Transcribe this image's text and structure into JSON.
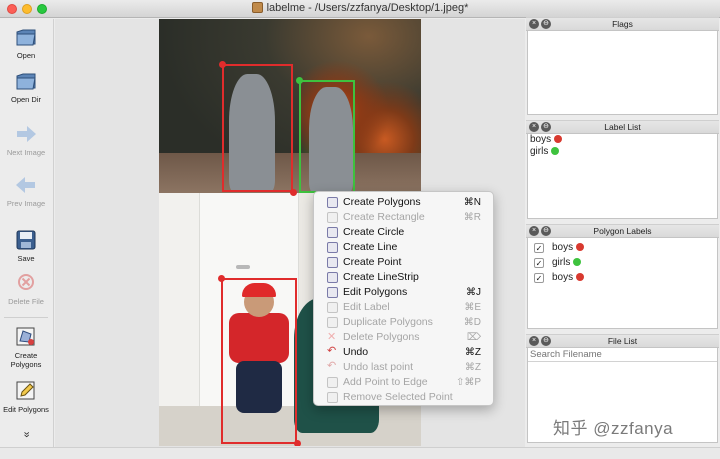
{
  "window": {
    "title": "labelme - /Users/zzfanya/Desktop/1.jpeg*"
  },
  "toolbar": {
    "items": [
      {
        "label": "Open",
        "icon": "folder-icon",
        "enabled": true
      },
      {
        "label": "Open Dir",
        "icon": "folder-icon",
        "enabled": true
      },
      {
        "label": "Next Image",
        "icon": "arrow-right-icon",
        "enabled": false
      },
      {
        "label": "Prev Image",
        "icon": "arrow-left-icon",
        "enabled": false
      },
      {
        "label": "Save",
        "icon": "floppy-icon",
        "enabled": true
      },
      {
        "label": "Delete File",
        "icon": "delete-icon",
        "enabled": false
      },
      {
        "label": "Create Polygons",
        "icon": "polygon-icon",
        "enabled": true
      },
      {
        "label": "Edit Polygons",
        "icon": "pencil-icon",
        "enabled": true
      }
    ],
    "more": "»"
  },
  "context_menu": {
    "items": [
      {
        "label": "Create Polygons",
        "shortcut": "⌘N",
        "enabled": true
      },
      {
        "label": "Create Rectangle",
        "shortcut": "⌘R",
        "enabled": false
      },
      {
        "label": "Create Circle",
        "shortcut": "",
        "enabled": true
      },
      {
        "label": "Create Line",
        "shortcut": "",
        "enabled": true
      },
      {
        "label": "Create Point",
        "shortcut": "",
        "enabled": true
      },
      {
        "label": "Create LineStrip",
        "shortcut": "",
        "enabled": true
      },
      {
        "label": "Edit Polygons",
        "shortcut": "⌘J",
        "enabled": true
      },
      {
        "label": "Edit Label",
        "shortcut": "⌘E",
        "enabled": false
      },
      {
        "label": "Duplicate Polygons",
        "shortcut": "⌘D",
        "enabled": false
      },
      {
        "label": "Delete Polygons",
        "shortcut": "⌦",
        "enabled": false
      },
      {
        "label": "Undo",
        "shortcut": "⌘Z",
        "enabled": true
      },
      {
        "label": "Undo last point",
        "shortcut": "⌘Z",
        "enabled": false
      },
      {
        "label": "Add Point to Edge",
        "shortcut": "⇧⌘P",
        "enabled": false
      },
      {
        "label": "Remove Selected Point",
        "shortcut": "",
        "enabled": false
      }
    ]
  },
  "panels": {
    "flags": {
      "title": "Flags"
    },
    "label_list": {
      "title": "Label List",
      "items": [
        {
          "label": "boys",
          "color": "#d8392f"
        },
        {
          "label": "girls",
          "color": "#3ec23e"
        }
      ]
    },
    "polygon_labels": {
      "title": "Polygon Labels",
      "items": [
        {
          "label": "boys",
          "checked": true,
          "color": "#d8392f"
        },
        {
          "label": "girls",
          "checked": true,
          "color": "#3ec23e"
        },
        {
          "label": "boys",
          "checked": true,
          "color": "#d8392f"
        }
      ]
    },
    "file_list": {
      "title": "File List",
      "search_placeholder": "Search Filename"
    }
  },
  "colors": {
    "boys": "#e02c2c",
    "girls": "#3ec23e"
  },
  "watermark": "知乎 @zzfanya"
}
